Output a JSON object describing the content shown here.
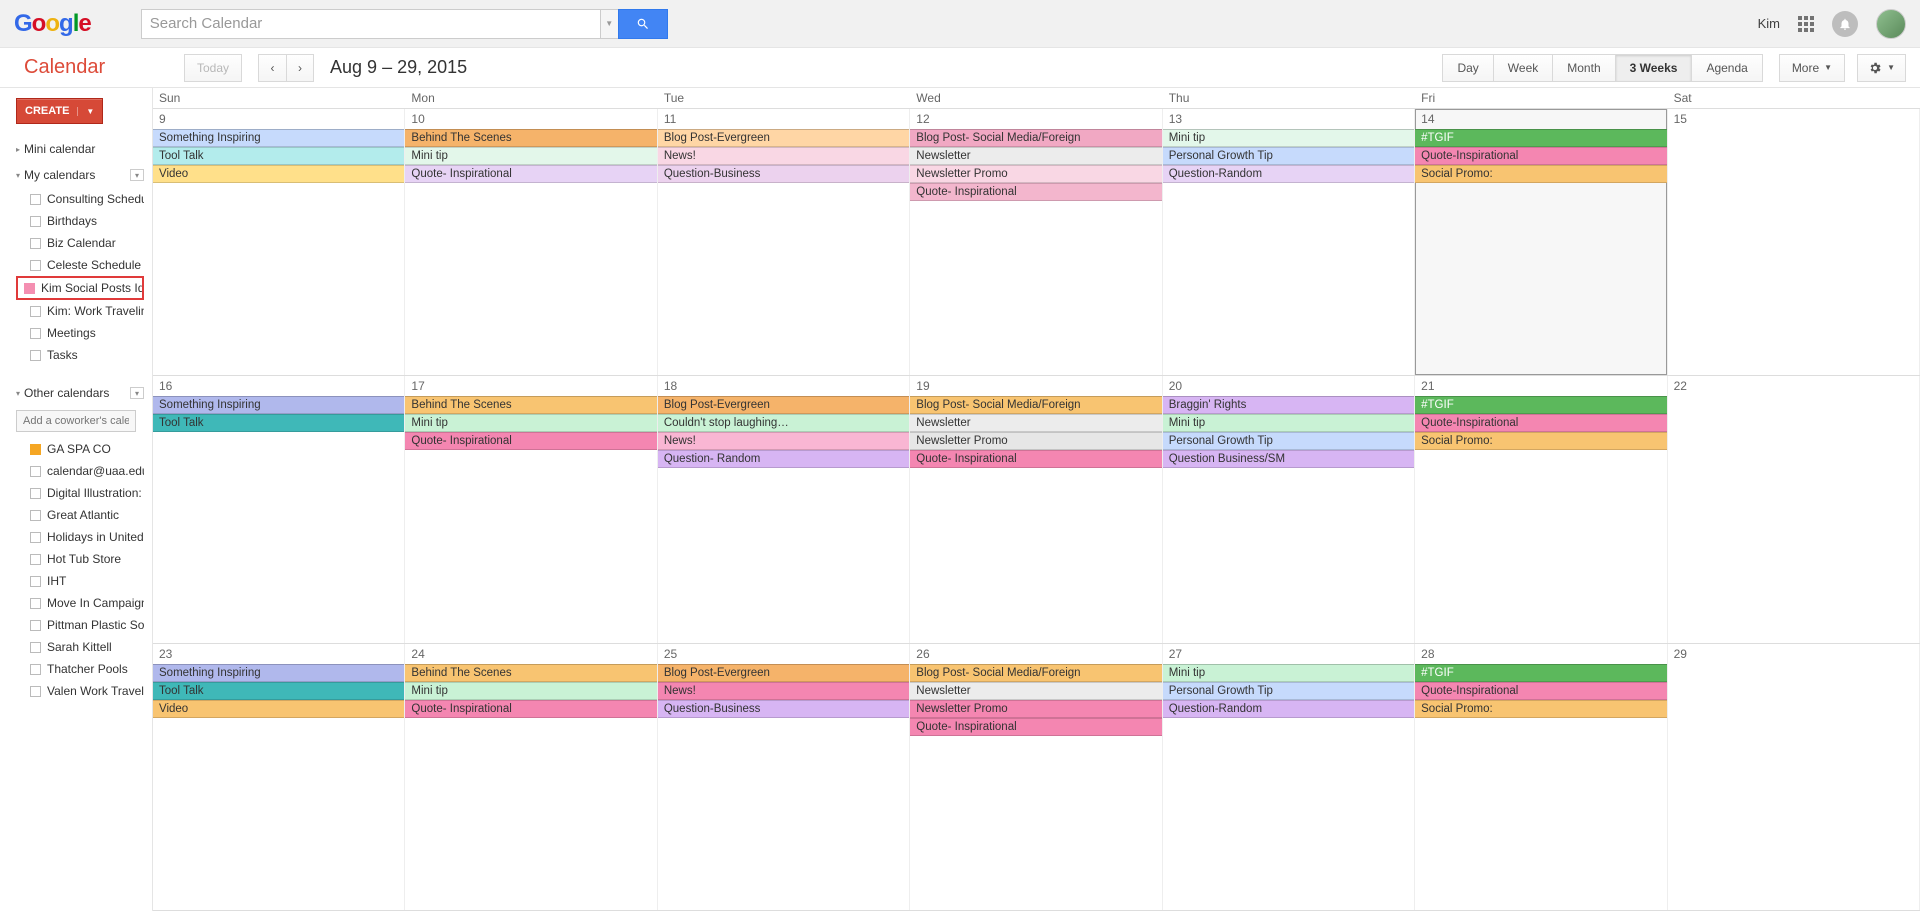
{
  "header": {
    "search_placeholder": "Search Calendar",
    "user_name": "Kim"
  },
  "toolbar": {
    "app_title": "Calendar",
    "today_label": "Today",
    "date_range": "Aug 9 – 29, 2015",
    "views": [
      "Day",
      "Week",
      "Month",
      "3 Weeks",
      "Agenda"
    ],
    "active_view": "3 Weeks",
    "more_label": "More"
  },
  "sidebar": {
    "create_label": "CREATE",
    "mini_calendar_label": "Mini calendar",
    "my_calendars_label": "My calendars",
    "my_calendars": [
      {
        "name": "Consulting Schedule"
      },
      {
        "name": "Birthdays"
      },
      {
        "name": "Biz Calendar"
      },
      {
        "name": "Celeste Schedule"
      },
      {
        "name": "Kim Social Posts Ideas",
        "highlight": true
      },
      {
        "name": "Kim: Work Traveling …"
      },
      {
        "name": "Meetings"
      },
      {
        "name": "Tasks"
      }
    ],
    "other_calendars_label": "Other calendars",
    "coworker_placeholder": "Add a coworker's calendar",
    "other_calendars": [
      {
        "name": "GA SPA CO",
        "color": "orange"
      },
      {
        "name": "calendar@uaa.edu"
      },
      {
        "name": "Digital Illustration: C…"
      },
      {
        "name": "Great Atlantic"
      },
      {
        "name": "Holidays in United St…"
      },
      {
        "name": "Hot Tub Store"
      },
      {
        "name": "IHT"
      },
      {
        "name": "Move In Campaign"
      },
      {
        "name": "Pittman Plastic Social"
      },
      {
        "name": "Sarah Kittell"
      },
      {
        "name": "Thatcher Pools"
      },
      {
        "name": "Valen Work Travelin…"
      }
    ]
  },
  "calendar": {
    "dow": [
      "Sun",
      "Mon",
      "Tue",
      "Wed",
      "Thu",
      "Fri",
      "Sat"
    ],
    "weeks": [
      {
        "days": [
          {
            "n": 9,
            "events": [
              {
                "t": "Something Inspiring",
                "c": "c-blue"
              },
              {
                "t": "Tool Talk",
                "c": "c-teal"
              },
              {
                "t": "Video",
                "c": "c-yellow"
              }
            ]
          },
          {
            "n": 10,
            "events": [
              {
                "t": "Behind The Scenes",
                "c": "c-orange"
              },
              {
                "t": "Mini tip",
                "c": "c-mintL"
              },
              {
                "t": "Quote- Inspirational",
                "c": "c-lav"
              }
            ]
          },
          {
            "n": 11,
            "events": [
              {
                "t": "Blog Post-Evergreen",
                "c": "c-peach"
              },
              {
                "t": "News!",
                "c": "c-rose"
              },
              {
                "t": "Question-Business",
                "c": "c-lavP"
              }
            ]
          },
          {
            "n": 12,
            "events": [
              {
                "t": "Blog Post- Social Media/Foreign",
                "c": "c-pink"
              },
              {
                "t": "Newsletter",
                "c": "c-grayL"
              },
              {
                "t": "Newsletter Promo",
                "c": "c-rose"
              },
              {
                "t": "Quote- Inspirational",
                "c": "c-roseD"
              }
            ]
          },
          {
            "n": 13,
            "events": [
              {
                "t": "Mini tip",
                "c": "c-mintL"
              },
              {
                "t": "Personal Growth Tip",
                "c": "c-blue"
              },
              {
                "t": "Question-Random",
                "c": "c-lav"
              }
            ]
          },
          {
            "n": 14,
            "today": true,
            "events": [
              {
                "t": "#TGIF",
                "c": "c-green"
              },
              {
                "t": "Quote-Inspirational",
                "c": "c-pinkD"
              },
              {
                "t": "Social Promo:",
                "c": "c-amber"
              }
            ]
          },
          {
            "n": 15,
            "events": []
          }
        ]
      },
      {
        "days": [
          {
            "n": 16,
            "events": [
              {
                "t": "Something Inspiring",
                "c": "c-periw"
              },
              {
                "t": "Tool Talk",
                "c": "c-tealB"
              }
            ]
          },
          {
            "n": 17,
            "events": [
              {
                "t": "Behind The Scenes",
                "c": "c-amber"
              },
              {
                "t": "Mini tip",
                "c": "c-mint"
              },
              {
                "t": "Quote- Inspirational",
                "c": "c-pinkD"
              }
            ]
          },
          {
            "n": 18,
            "events": [
              {
                "t": "Blog Post-Evergreen",
                "c": "c-orange"
              },
              {
                "t": "Couldn't stop laughing…",
                "c": "c-mint"
              },
              {
                "t": "News!",
                "c": "c-pinkM"
              },
              {
                "t": "Question- Random",
                "c": "c-purple"
              }
            ]
          },
          {
            "n": 19,
            "events": [
              {
                "t": "Blog Post- Social Media/Foreign",
                "c": "c-amber"
              },
              {
                "t": "Newsletter",
                "c": "c-grayL"
              },
              {
                "t": "Newsletter Promo",
                "c": "c-gray"
              },
              {
                "t": "Quote- Inspirational",
                "c": "c-pinkD"
              }
            ]
          },
          {
            "n": 20,
            "events": [
              {
                "t": "Braggin' Rights",
                "c": "c-purple"
              },
              {
                "t": "Mini tip",
                "c": "c-mint"
              },
              {
                "t": "Personal Growth Tip",
                "c": "c-blue"
              },
              {
                "t": "Question Business/SM",
                "c": "c-purple"
              }
            ]
          },
          {
            "n": 21,
            "events": [
              {
                "t": "#TGIF",
                "c": "c-green"
              },
              {
                "t": "Quote-Inspirational",
                "c": "c-pinkD"
              },
              {
                "t": "Social Promo:",
                "c": "c-amber"
              }
            ]
          },
          {
            "n": 22,
            "events": []
          }
        ]
      },
      {
        "days": [
          {
            "n": 23,
            "events": [
              {
                "t": "Something Inspiring",
                "c": "c-periw"
              },
              {
                "t": "Tool Talk",
                "c": "c-tealB"
              },
              {
                "t": "Video",
                "c": "c-amber"
              }
            ]
          },
          {
            "n": 24,
            "events": [
              {
                "t": "Behind The Scenes",
                "c": "c-amber"
              },
              {
                "t": "Mini tip",
                "c": "c-mint"
              },
              {
                "t": "Quote- Inspirational",
                "c": "c-pinkD"
              }
            ]
          },
          {
            "n": 25,
            "events": [
              {
                "t": "Blog Post-Evergreen",
                "c": "c-orange"
              },
              {
                "t": "News!",
                "c": "c-pinkD"
              },
              {
                "t": "Question-Business",
                "c": "c-purple"
              }
            ]
          },
          {
            "n": 26,
            "events": [
              {
                "t": "Blog Post- Social Media/Foreign",
                "c": "c-amber"
              },
              {
                "t": "Newsletter",
                "c": "c-grayL"
              },
              {
                "t": "Newsletter Promo",
                "c": "c-pinkD"
              },
              {
                "t": "Quote- Inspirational",
                "c": "c-pinkD"
              }
            ]
          },
          {
            "n": 27,
            "events": [
              {
                "t": "Mini tip",
                "c": "c-mint"
              },
              {
                "t": "Personal Growth Tip",
                "c": "c-blue"
              },
              {
                "t": "Question-Random",
                "c": "c-purple"
              }
            ]
          },
          {
            "n": 28,
            "events": [
              {
                "t": "#TGIF",
                "c": "c-green"
              },
              {
                "t": "Quote-Inspirational",
                "c": "c-pinkD"
              },
              {
                "t": "Social Promo:",
                "c": "c-amber"
              }
            ]
          },
          {
            "n": 29,
            "events": []
          }
        ]
      }
    ]
  }
}
